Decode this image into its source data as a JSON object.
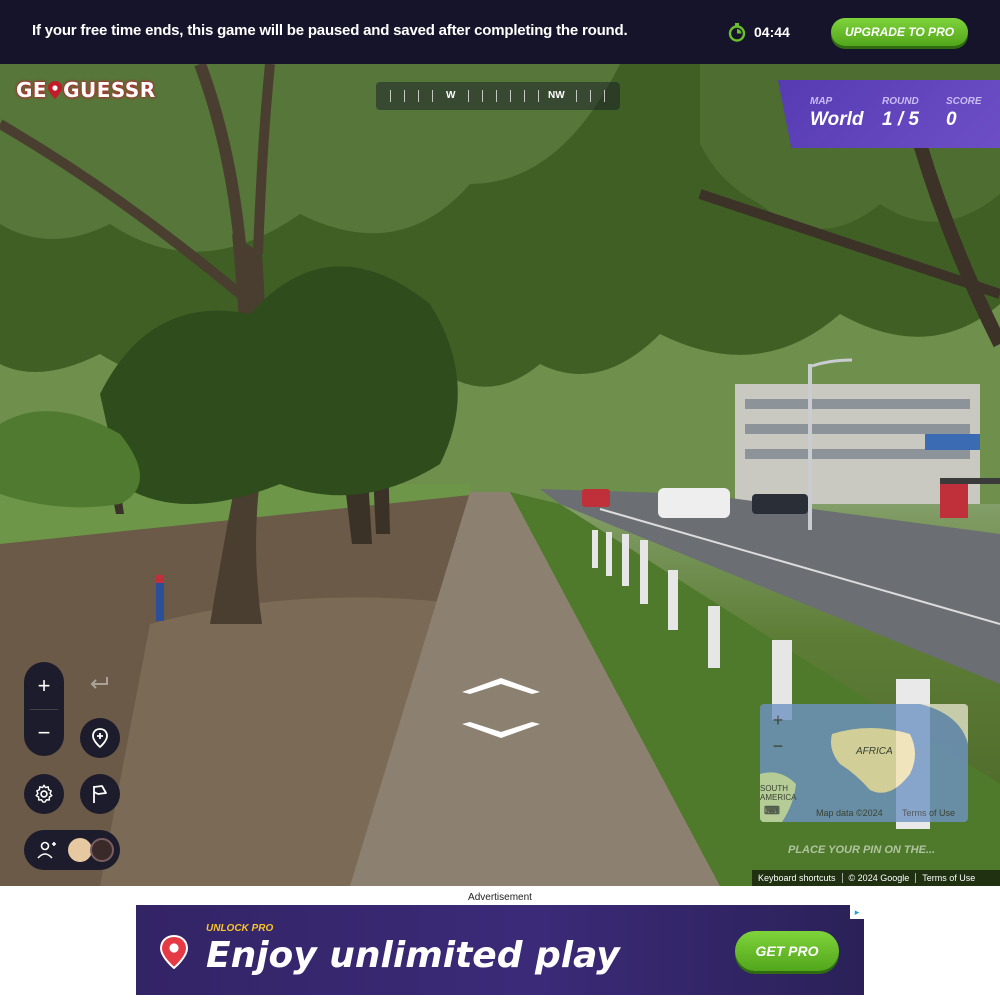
{
  "banner": {
    "message": "If your free time ends, this game will be paused and saved after completing the round.",
    "timer": "04:44",
    "upgrade_label": "UPGRADE TO PRO"
  },
  "logo": {
    "text_left": "GE",
    "text_right": "GUESSR"
  },
  "compass": {
    "west": "W",
    "northwest": "NW"
  },
  "status": {
    "map_label": "MAP",
    "map_value": "World",
    "round_label": "ROUND",
    "round_value": "1 / 5",
    "score_label": "SCORE",
    "score_value": "0"
  },
  "controls": {
    "zoom_in": "+",
    "zoom_out": "−"
  },
  "minimap": {
    "zoom_in": "+",
    "zoom_out": "−",
    "continent_label": "AFRICA",
    "south_america_label": "SOUTH AMERICA",
    "map_data": "Map data ©2024",
    "terms": "Terms of Use",
    "place_pin": "PLACE YOUR PIN ON THE..."
  },
  "footer": {
    "keyboard": "Keyboard shortcuts",
    "copyright": "© 2024 Google",
    "terms": "Terms of Use"
  },
  "ad": {
    "label": "Advertisement",
    "eyebrow": "UNLOCK PRO",
    "headline": "Enjoy unlimited play",
    "cta": "GET PRO"
  },
  "colors": {
    "banner_bg": "#15142a",
    "accent_green": "#6bc02a",
    "panel_purple": "#5f43bd",
    "brand_red": "#c31b2a"
  }
}
